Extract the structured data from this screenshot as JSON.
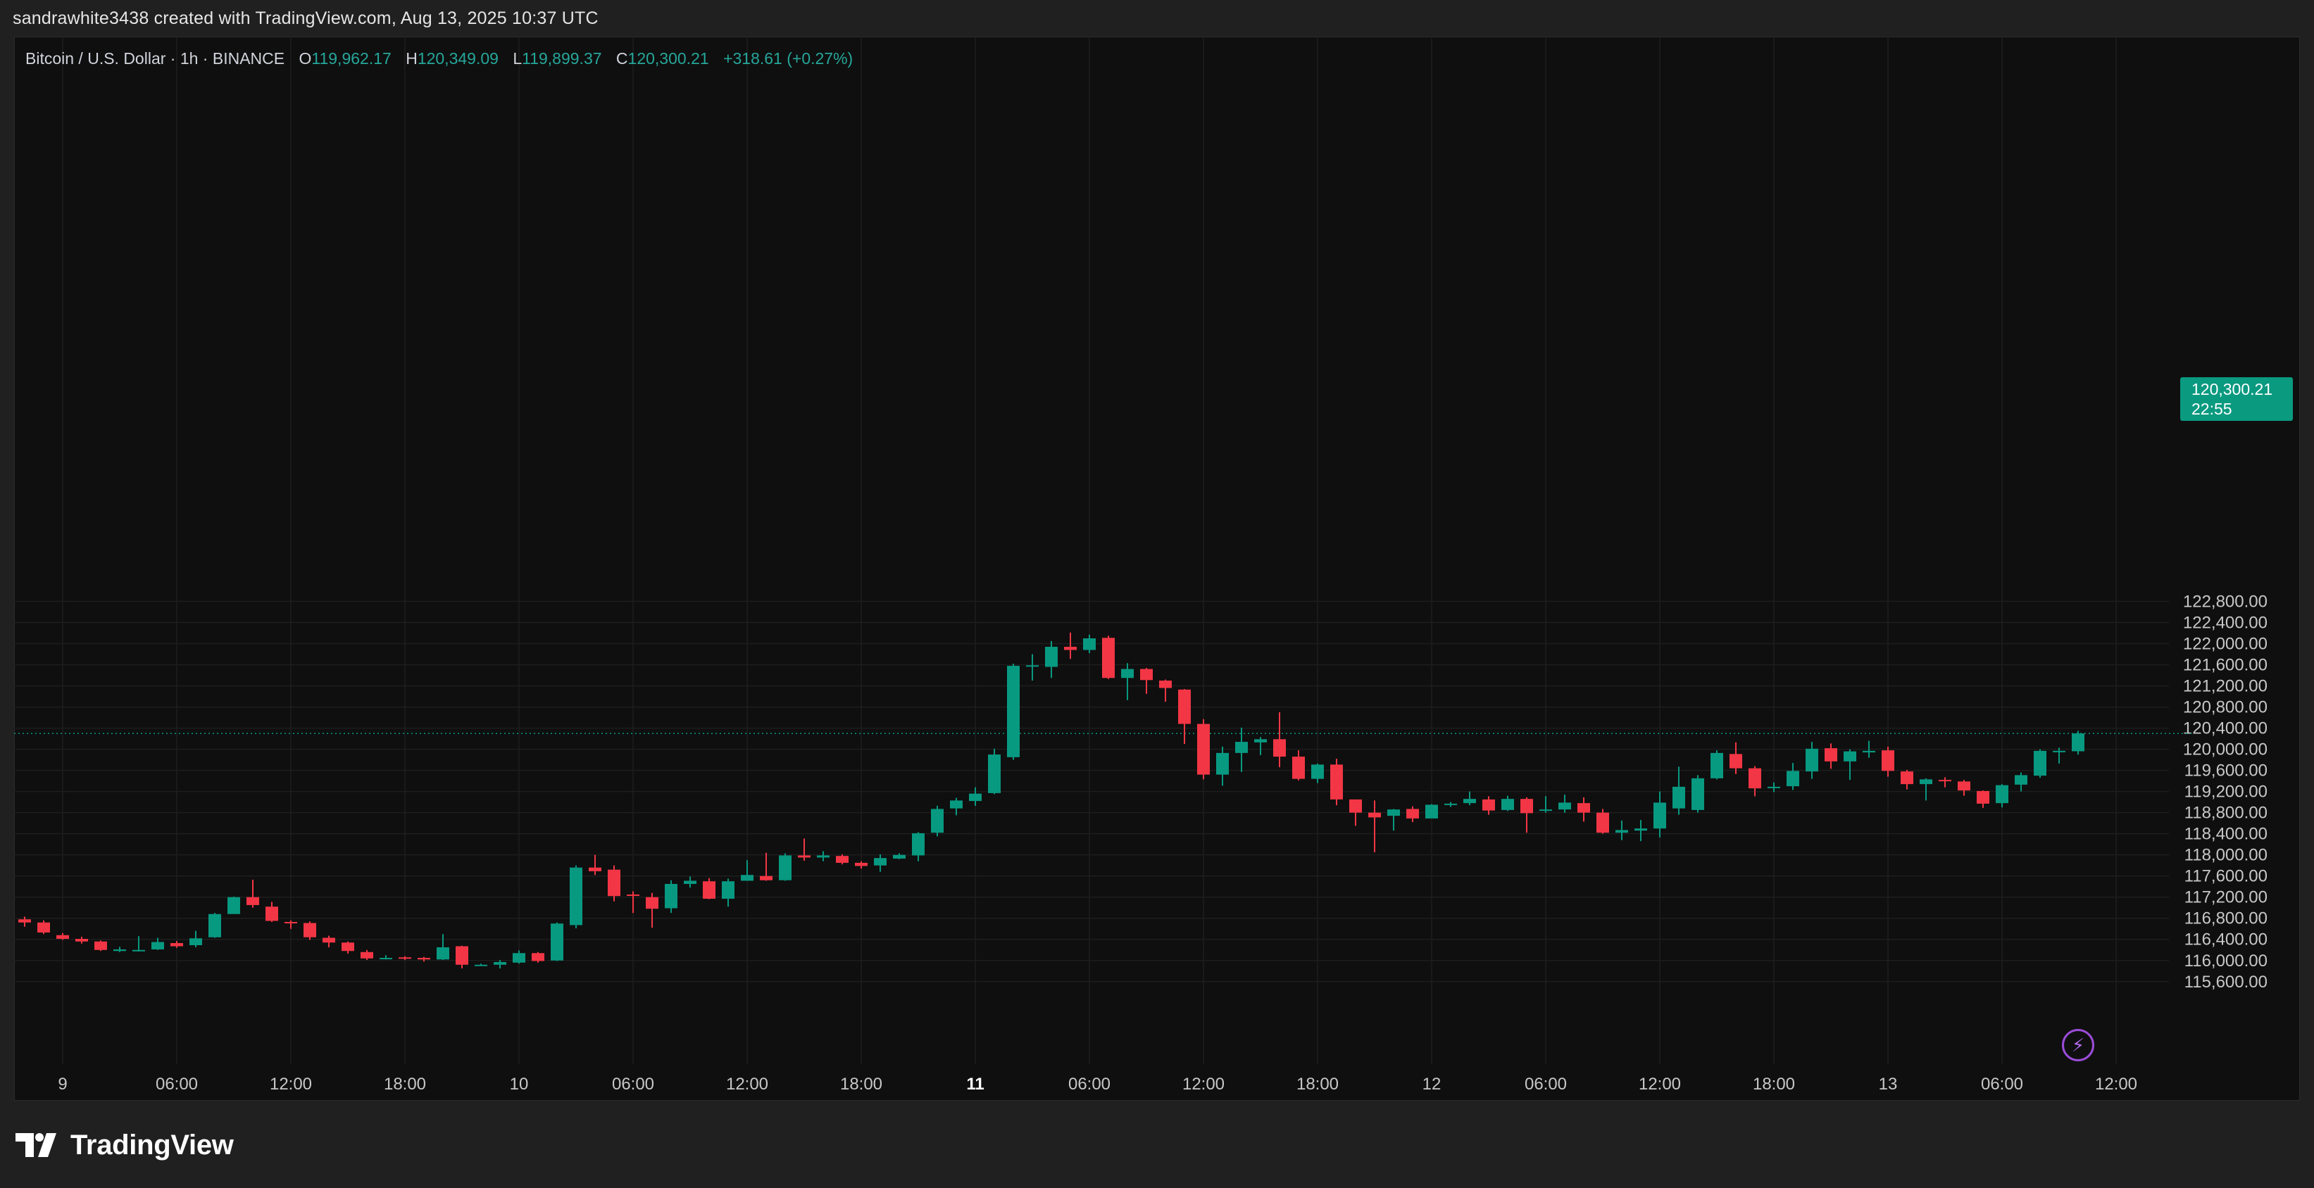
{
  "attribution": "sandrawhite3438 created with TradingView.com, Aug 13, 2025 10:37 UTC",
  "legend": {
    "symbol": "Bitcoin / U.S. Dollar · 1h · BINANCE",
    "open_label": "O",
    "open": "119,962.17",
    "high_label": "H",
    "high": "120,349.09",
    "low_label": "L",
    "low": "119,899.37",
    "close_label": "C",
    "close": "120,300.21",
    "change": "+318.61 (+0.27%)"
  },
  "price_tag": {
    "price": "120,300.21",
    "countdown": "22:55"
  },
  "logo_text": "TradingView",
  "colors": {
    "up": "#089981",
    "down": "#f23645",
    "background": "#0f0f0f",
    "frame": "#202020",
    "grid": "#1e1e1e"
  },
  "icons": {
    "logo": "tradingview-logo-icon",
    "bolt": "lightning-icon"
  },
  "chart_data": {
    "type": "candlestick",
    "title": "Bitcoin / U.S. Dollar · 1h · BINANCE",
    "xlabel": "",
    "ylabel": "",
    "ylim": [
      115300,
      123000
    ],
    "y_ticks": [
      115600,
      116000,
      116400,
      116800,
      117200,
      117600,
      118000,
      118400,
      118800,
      119200,
      119600,
      120000,
      120400,
      120800,
      121200,
      121600,
      122000,
      122400,
      122800
    ],
    "y_tick_labels": [
      "115,600.00",
      "116,000.00",
      "116,400.00",
      "116,800.00",
      "117,200.00",
      "117,600.00",
      "118,000.00",
      "118,400.00",
      "118,800.00",
      "119,200.00",
      "119,600.00",
      "120,000.00",
      "120,400.00",
      "120,800.00",
      "121,200.00",
      "121,600.00",
      "122,000.00",
      "122,400.00",
      "122,800.00"
    ],
    "x_ticks": [
      {
        "label": "9",
        "bar": 2,
        "bold": false
      },
      {
        "label": "06:00",
        "bar": 8,
        "bold": false
      },
      {
        "label": "12:00",
        "bar": 14,
        "bold": false
      },
      {
        "label": "18:00",
        "bar": 20,
        "bold": false
      },
      {
        "label": "10",
        "bar": 26,
        "bold": false
      },
      {
        "label": "06:00",
        "bar": 32,
        "bold": false
      },
      {
        "label": "12:00",
        "bar": 38,
        "bold": false
      },
      {
        "label": "18:00",
        "bar": 44,
        "bold": false
      },
      {
        "label": "11",
        "bar": 50,
        "bold": true
      },
      {
        "label": "06:00",
        "bar": 56,
        "bold": false
      },
      {
        "label": "12:00",
        "bar": 62,
        "bold": false
      },
      {
        "label": "18:00",
        "bar": 68,
        "bold": false
      },
      {
        "label": "12",
        "bar": 74,
        "bold": false
      },
      {
        "label": "06:00",
        "bar": 80,
        "bold": false
      },
      {
        "label": "12:00",
        "bar": 86,
        "bold": false
      },
      {
        "label": "18:00",
        "bar": 92,
        "bold": false
      },
      {
        "label": "13",
        "bar": 98,
        "bold": false
      },
      {
        "label": "06:00",
        "bar": 104,
        "bold": false
      },
      {
        "label": "12:00",
        "bar": 110,
        "bold": false
      }
    ],
    "current_price": 120300.21,
    "candles": [
      [
        116780,
        116720,
        116830,
        116640
      ],
      [
        116720,
        116530,
        116760,
        116500
      ],
      [
        116480,
        116410,
        116520,
        116390
      ],
      [
        116410,
        116360,
        116450,
        116320
      ],
      [
        116360,
        116200,
        116380,
        116180
      ],
      [
        116180,
        116210,
        116260,
        116160
      ],
      [
        116190,
        116200,
        116460,
        116170
      ],
      [
        116210,
        116350,
        116430,
        116200
      ],
      [
        116330,
        116270,
        116370,
        116240
      ],
      [
        116290,
        116420,
        116560,
        116250
      ],
      [
        116440,
        116880,
        116900,
        116430
      ],
      [
        116880,
        117200,
        117210,
        116890
      ],
      [
        117200,
        117050,
        117530,
        117000
      ],
      [
        117020,
        116750,
        117110,
        116730
      ],
      [
        116730,
        116710,
        116760,
        116600
      ],
      [
        116710,
        116440,
        116740,
        116390
      ],
      [
        116430,
        116340,
        116470,
        116250
      ],
      [
        116340,
        116180,
        116360,
        116130
      ],
      [
        116160,
        116040,
        116200,
        116010
      ],
      [
        116050,
        116050,
        116100,
        116020
      ],
      [
        116060,
        116040,
        116080,
        116010
      ],
      [
        116050,
        116020,
        116070,
        115980
      ],
      [
        116020,
        116250,
        116500,
        116010
      ],
      [
        116270,
        115920,
        116280,
        115850
      ],
      [
        115920,
        115920,
        115940,
        115900
      ],
      [
        115920,
        115970,
        116010,
        115850
      ],
      [
        115960,
        116140,
        116190,
        115940
      ],
      [
        116140,
        115990,
        116160,
        115960
      ],
      [
        116000,
        116700,
        116720,
        115990
      ],
      [
        116670,
        117760,
        117800,
        116610
      ],
      [
        117760,
        117690,
        118000,
        117620
      ],
      [
        117720,
        117220,
        117800,
        117120
      ],
      [
        117250,
        117230,
        117310,
        116900
      ],
      [
        117200,
        116980,
        117280,
        116620
      ],
      [
        116990,
        117450,
        117520,
        116900
      ],
      [
        117450,
        117510,
        117590,
        117380
      ],
      [
        117500,
        117170,
        117560,
        117160
      ],
      [
        117170,
        117500,
        117550,
        117020
      ],
      [
        117510,
        117620,
        117900,
        117520
      ],
      [
        117600,
        117520,
        118040,
        117510
      ],
      [
        117520,
        117990,
        118030,
        117510
      ],
      [
        117990,
        117950,
        118310,
        117890
      ],
      [
        117950,
        117990,
        118070,
        117880
      ],
      [
        117980,
        117850,
        118010,
        117820
      ],
      [
        117850,
        117790,
        117880,
        117740
      ],
      [
        117800,
        117940,
        118010,
        117680
      ],
      [
        117930,
        118000,
        118030,
        117920
      ],
      [
        117990,
        118410,
        118430,
        117880
      ],
      [
        118420,
        118870,
        118930,
        118350
      ],
      [
        118880,
        119030,
        119080,
        118750
      ],
      [
        119020,
        119160,
        119280,
        118930
      ],
      [
        119170,
        119900,
        120010,
        119150
      ],
      [
        119850,
        121580,
        121620,
        119800
      ],
      [
        121580,
        121590,
        121800,
        121300
      ],
      [
        121560,
        121940,
        122050,
        121350
      ],
      [
        121940,
        121880,
        122210,
        121710
      ],
      [
        121880,
        122100,
        122170,
        121820
      ],
      [
        122110,
        121350,
        122150,
        121330
      ],
      [
        121350,
        121520,
        121630,
        120930
      ],
      [
        121520,
        121310,
        121540,
        121050
      ],
      [
        121300,
        121160,
        121320,
        120900
      ],
      [
        121130,
        120480,
        121140,
        120100
      ],
      [
        120480,
        119520,
        120570,
        119430
      ],
      [
        119520,
        119930,
        120050,
        119310
      ],
      [
        119930,
        120140,
        120410,
        119570
      ],
      [
        120130,
        120190,
        120230,
        119890
      ],
      [
        120190,
        119860,
        120700,
        119660
      ],
      [
        119860,
        119440,
        119980,
        119410
      ],
      [
        119440,
        119710,
        119730,
        119360
      ],
      [
        119710,
        119050,
        119820,
        118940
      ],
      [
        119050,
        118800,
        119020,
        118550
      ],
      [
        118800,
        118710,
        119030,
        118050
      ],
      [
        118740,
        118860,
        118870,
        118460
      ],
      [
        118870,
        118690,
        118920,
        118620
      ],
      [
        118690,
        118950,
        118960,
        118800
      ],
      [
        118950,
        118970,
        119000,
        118910
      ],
      [
        118980,
        119060,
        119200,
        118940
      ],
      [
        119050,
        118840,
        119110,
        118760
      ],
      [
        118850,
        119060,
        119120,
        118830
      ],
      [
        119060,
        118790,
        119090,
        118420
      ],
      [
        118840,
        118860,
        119110,
        118800
      ],
      [
        118860,
        118990,
        119140,
        118800
      ],
      [
        118980,
        118800,
        119090,
        118630
      ],
      [
        118800,
        118420,
        118870,
        118400
      ],
      [
        118420,
        118470,
        118650,
        118280
      ],
      [
        118460,
        118500,
        118660,
        118260
      ],
      [
        118500,
        118990,
        119200,
        118330
      ],
      [
        118880,
        119290,
        119670,
        118760
      ],
      [
        118850,
        119450,
        119510,
        118800
      ],
      [
        119450,
        119930,
        119980,
        119430
      ],
      [
        119910,
        119640,
        120130,
        119530
      ],
      [
        119640,
        119260,
        119680,
        119110
      ],
      [
        119270,
        119290,
        119370,
        119190
      ],
      [
        119300,
        119590,
        119740,
        119230
      ],
      [
        119580,
        120010,
        120140,
        119440
      ],
      [
        120020,
        119770,
        120110,
        119630
      ],
      [
        119770,
        119960,
        120000,
        119420
      ],
      [
        119940,
        119970,
        120160,
        119840
      ],
      [
        119980,
        119590,
        120050,
        119480
      ],
      [
        119580,
        119340,
        119610,
        119240
      ],
      [
        119340,
        119430,
        119450,
        119030
      ],
      [
        119420,
        119400,
        119470,
        119280
      ],
      [
        119390,
        119220,
        119420,
        119120
      ],
      [
        119210,
        118970,
        119220,
        118890
      ],
      [
        118980,
        119320,
        119340,
        118900
      ],
      [
        119330,
        119510,
        119560,
        119200
      ],
      [
        119500,
        119970,
        120000,
        119460
      ],
      [
        119960,
        119970,
        120030,
        119730
      ],
      [
        119962.17,
        120300.21,
        120349.09,
        119899.37
      ]
    ]
  }
}
